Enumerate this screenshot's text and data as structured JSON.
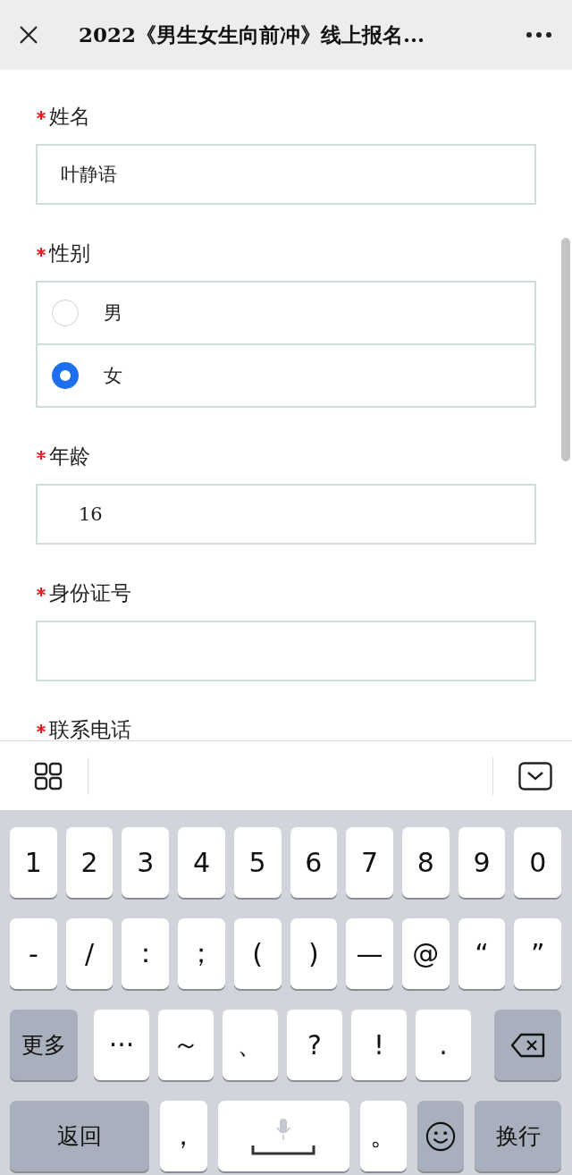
{
  "header": {
    "title": "2022《男生女生向前冲》线上报名..."
  },
  "form": {
    "fields": [
      {
        "kind": "text",
        "label": "姓名",
        "required": true,
        "value": "叶静语"
      },
      {
        "kind": "radio",
        "label": "性别",
        "required": true,
        "options": [
          {
            "label": "男",
            "selected": false
          },
          {
            "label": "女",
            "selected": true
          }
        ]
      },
      {
        "kind": "text",
        "label": "年龄",
        "required": true,
        "value": "16"
      },
      {
        "kind": "text",
        "label": "身份证号",
        "required": true
      },
      {
        "kind": "label_only",
        "label": "联系电话",
        "required": true
      }
    ]
  },
  "keyboard": {
    "number_keys": [
      {
        "kind": "char",
        "label": "1"
      },
      {
        "kind": "char",
        "label": "2"
      },
      {
        "kind": "char",
        "label": "3"
      },
      {
        "kind": "char",
        "label": "4"
      },
      {
        "kind": "char",
        "label": "5"
      },
      {
        "kind": "char",
        "label": "6"
      },
      {
        "kind": "char",
        "label": "7"
      },
      {
        "kind": "char",
        "label": "8"
      },
      {
        "kind": "char",
        "label": "9"
      },
      {
        "kind": "char",
        "label": "0"
      }
    ],
    "symbol_keys": [
      {
        "kind": "char",
        "label": "-"
      },
      {
        "kind": "char",
        "label": "/"
      },
      {
        "kind": "char",
        "label": "："
      },
      {
        "kind": "char",
        "label": "；"
      },
      {
        "kind": "char",
        "label": "("
      },
      {
        "kind": "char",
        "label": ")"
      },
      {
        "kind": "char",
        "label": "—"
      },
      {
        "kind": "char",
        "label": "@"
      },
      {
        "kind": "char",
        "label": "“"
      },
      {
        "kind": "char",
        "label": "”"
      }
    ],
    "punctuation_keys": [
      {
        "kind": "more",
        "label": "更多"
      },
      {
        "kind": "char",
        "label": "···"
      },
      {
        "kind": "char",
        "label": "～"
      },
      {
        "kind": "char",
        "label": "、"
      },
      {
        "kind": "char",
        "label": "?"
      },
      {
        "kind": "char",
        "label": "!"
      },
      {
        "kind": "char",
        "label": "."
      },
      {
        "kind": "delete"
      }
    ],
    "bottom_keys": [
      {
        "kind": "back",
        "label": "返回"
      },
      {
        "kind": "char",
        "label": "，"
      },
      {
        "kind": "space"
      },
      {
        "kind": "char",
        "label": "。"
      },
      {
        "kind": "emoji"
      },
      {
        "kind": "enter",
        "label": "换行"
      }
    ]
  }
}
